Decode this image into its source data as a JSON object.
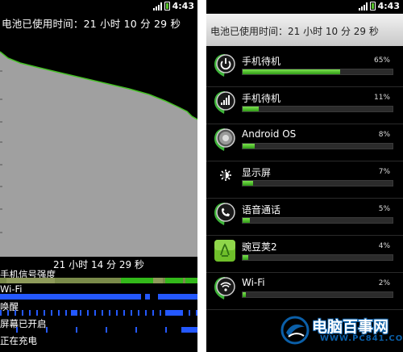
{
  "status_bar": {
    "time": "4:43"
  },
  "left_screen": {
    "title": "电池已使用时间：21 小时 10 分 29 秒",
    "duration_label": "21 小时 14 分 29 秒",
    "tracks": [
      {
        "label": "手机信号强度"
      },
      {
        "label": "Wi-Fi"
      },
      {
        "label": "唤醒"
      },
      {
        "label": "屏幕已开启"
      },
      {
        "label": "正在充电"
      }
    ],
    "colors": {
      "graph_fill": "#a0a0a0",
      "graph_line": "#45c026",
      "track_blue": "#2458ff",
      "signal_green": "#33b81a",
      "signal_olive": "#7a8a4a"
    }
  },
  "right_screen": {
    "header": "电池已使用时间：21 小时 10 分 29 秒",
    "items": [
      {
        "name": "手机待机",
        "percent": "65%",
        "value": 0.65,
        "icon": "power-icon"
      },
      {
        "name": "手机待机",
        "percent": "11%",
        "value": 0.11,
        "icon": "signal-bars-icon"
      },
      {
        "name": "Android OS",
        "percent": "8%",
        "value": 0.08,
        "icon": "android-os-icon"
      },
      {
        "name": "显示屏",
        "percent": "7%",
        "value": 0.07,
        "icon": "brightness-icon"
      },
      {
        "name": "语音通话",
        "percent": "5%",
        "value": 0.05,
        "icon": "phone-icon"
      },
      {
        "name": "豌豆荚2",
        "percent": "4%",
        "value": 0.04,
        "icon": "wandoujia-app-icon"
      },
      {
        "name": "Wi-Fi",
        "percent": "2%",
        "value": 0.02,
        "icon": "wifi-icon"
      }
    ],
    "colors": {
      "bar": "#52c72d",
      "icon_green": "#3fb53a"
    }
  },
  "watermark": {
    "text": "电脑百事网",
    "url": "WWW.PC841.COM"
  }
}
